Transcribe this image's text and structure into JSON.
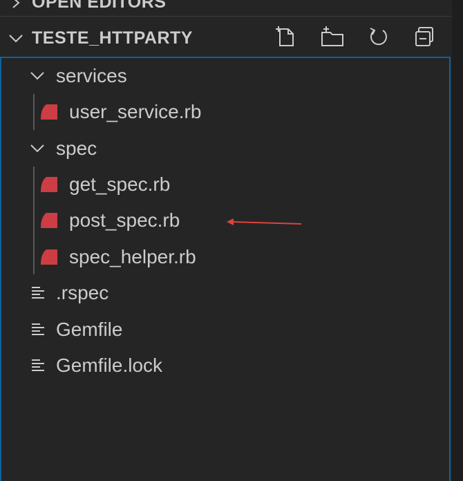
{
  "sections": {
    "open_editors": {
      "title": "OPEN EDITORS"
    },
    "project": {
      "title": "TESTE_HTTPARTY",
      "actions": [
        {
          "name": "new-file-icon"
        },
        {
          "name": "new-folder-icon"
        },
        {
          "name": "refresh-icon"
        },
        {
          "name": "collapse-all-icon"
        }
      ]
    }
  },
  "tree": {
    "services_folder": "services",
    "user_service": "user_service.rb",
    "spec_folder": "spec",
    "get_spec": "get_spec.rb",
    "post_spec": "post_spec.rb",
    "spec_helper": "spec_helper.rb",
    "rspec": ".rspec",
    "gemfile": "Gemfile",
    "gemfile_lock": "Gemfile.lock"
  },
  "colors": {
    "ruby": "#cc3e44",
    "accent": "#0e639c",
    "annotation": "#e0443a"
  }
}
